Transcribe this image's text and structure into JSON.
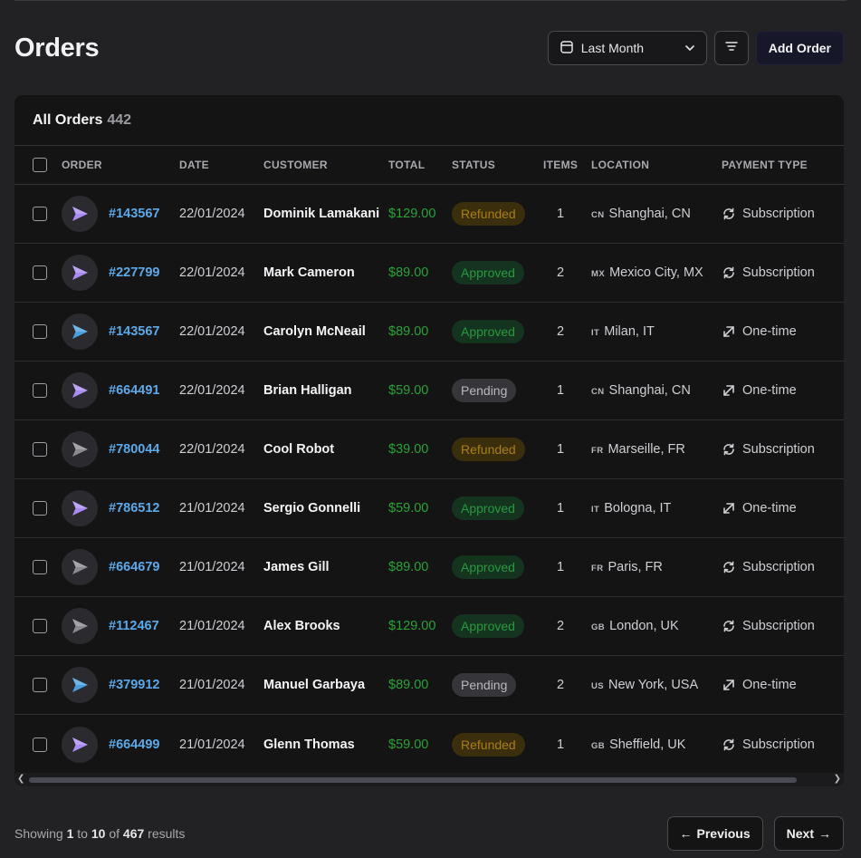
{
  "page": {
    "title": "Orders"
  },
  "header": {
    "date_filter": {
      "value": "Last Month",
      "icon": "calendar-icon"
    },
    "filter_icon": "filter-icon",
    "add_label": "Add Order"
  },
  "table": {
    "title": "All Orders",
    "count": "442",
    "columns": {
      "order": "ORDER",
      "date": "DATE",
      "customer": "CUSTOMER",
      "total": "TOTAL",
      "status": "STATUS",
      "items": "ITEMS",
      "location": "LOCATION",
      "payment": "PAYMENT TYPE"
    },
    "rows": [
      {
        "id": "#143567",
        "date": "22/01/2024",
        "customer": "Dominik Lamakani",
        "total": "$129.00",
        "status": "Refunded",
        "items": "1",
        "cc": "CN",
        "city": "Shanghai, CN",
        "payment": "Subscription",
        "avatar_color": "#a98bf5"
      },
      {
        "id": "#227799",
        "date": "22/01/2024",
        "customer": "Mark Cameron",
        "total": "$89.00",
        "status": "Approved",
        "items": "2",
        "cc": "MX",
        "city": "Mexico City, MX",
        "payment": "Subscription",
        "avatar_color": "#a98bf5"
      },
      {
        "id": "#143567",
        "date": "22/01/2024",
        "customer": "Carolyn McNeail",
        "total": "$89.00",
        "status": "Approved",
        "items": "2",
        "cc": "IT",
        "city": "Milan, IT",
        "payment": "One-time",
        "avatar_color": "#4b9fe0"
      },
      {
        "id": "#664491",
        "date": "22/01/2024",
        "customer": "Brian Halligan",
        "total": "$59.00",
        "status": "Pending",
        "items": "1",
        "cc": "CN",
        "city": "Shanghai, CN",
        "payment": "One-time",
        "avatar_color": "#a98bf5"
      },
      {
        "id": "#780044",
        "date": "22/01/2024",
        "customer": "Cool Robot",
        "total": "$39.00",
        "status": "Refunded",
        "items": "1",
        "cc": "FR",
        "city": "Marseille, FR",
        "payment": "Subscription",
        "avatar_color": "#8a8a92"
      },
      {
        "id": "#786512",
        "date": "21/01/2024",
        "customer": "Sergio Gonnelli",
        "total": "$59.00",
        "status": "Approved",
        "items": "1",
        "cc": "IT",
        "city": "Bologna, IT",
        "payment": "One-time",
        "avatar_color": "#a98bf5"
      },
      {
        "id": "#664679",
        "date": "21/01/2024",
        "customer": "James Gill",
        "total": "$89.00",
        "status": "Approved",
        "items": "1",
        "cc": "FR",
        "city": "Paris, FR",
        "payment": "Subscription",
        "avatar_color": "#8a8a92"
      },
      {
        "id": "#112467",
        "date": "21/01/2024",
        "customer": "Alex Brooks",
        "total": "$129.00",
        "status": "Approved",
        "items": "2",
        "cc": "GB",
        "city": "London, UK",
        "payment": "Subscription",
        "avatar_color": "#8a8a92"
      },
      {
        "id": "#379912",
        "date": "21/01/2024",
        "customer": "Manuel Garbaya",
        "total": "$89.00",
        "status": "Pending",
        "items": "2",
        "cc": "US",
        "city": "New York, USA",
        "payment": "One-time",
        "avatar_color": "#4b9fe0"
      },
      {
        "id": "#664499",
        "date": "21/01/2024",
        "customer": "Glenn Thomas",
        "total": "$59.00",
        "status": "Refunded",
        "items": "1",
        "cc": "GB",
        "city": "Sheffield, UK",
        "payment": "Subscription",
        "avatar_color": "#a98bf5"
      }
    ]
  },
  "status_colors": {
    "Refunded": {
      "bg": "#3a2e0c",
      "fg": "#a97e12"
    },
    "Approved": {
      "bg": "#143420",
      "fg": "#279a3e"
    },
    "Pending": {
      "bg": "#35353a",
      "fg": "#b8b8be"
    }
  },
  "payment_icons": {
    "Subscription": "refresh-icon",
    "One-time": "arrows-swap-icon"
  },
  "footer": {
    "showing": "Showing",
    "from": "1",
    "to_word": "to",
    "to": "10",
    "of_word": "of",
    "total": "467",
    "results": "results",
    "prev": "Previous",
    "next": "Next"
  }
}
